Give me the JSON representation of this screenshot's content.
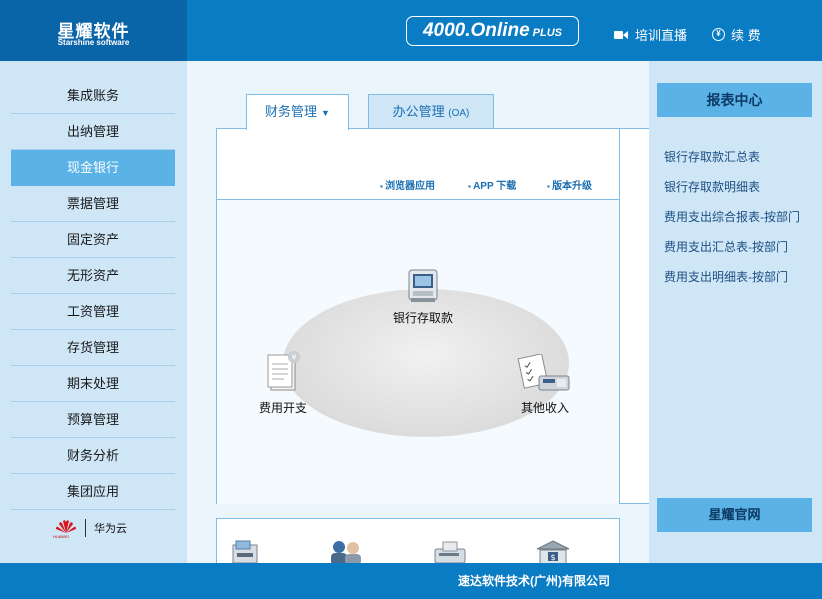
{
  "header": {
    "logo_title": "星耀软件",
    "logo_sub": "Starshine software",
    "product_name": "4000.Online",
    "product_plus": "PLUS",
    "live_label": "培训直播",
    "renew_label": "续 费"
  },
  "sidebar": {
    "items": [
      {
        "label": "集成账务"
      },
      {
        "label": "出纳管理"
      },
      {
        "label": "现金银行",
        "active": true
      },
      {
        "label": "票据管理"
      },
      {
        "label": "固定资产"
      },
      {
        "label": "无形资产"
      },
      {
        "label": "工资管理"
      },
      {
        "label": "存货管理"
      },
      {
        "label": "期末处理"
      },
      {
        "label": "预算管理"
      },
      {
        "label": "财务分析"
      },
      {
        "label": "集团应用"
      }
    ],
    "partner_brand": "HUAWEI",
    "partner_label": "华为云"
  },
  "tabs": {
    "finance": "财务管理",
    "office": "办公管理",
    "office_suffix": "(OA)"
  },
  "sublinks": {
    "browser": "浏览器应用",
    "app": "APP 下载",
    "upgrade": "版本升级"
  },
  "flow": {
    "bank": "银行存取款",
    "expense": "费用开支",
    "income": "其他收入"
  },
  "reports": {
    "title": "报表中心",
    "items": [
      "银行存取款汇总表",
      "银行存取款明细表",
      "费用支出综合报表-按部门",
      "费用支出汇总表-按部门",
      "费用支出明细表-按部门"
    ],
    "site_button": "星耀官网"
  },
  "footer": {
    "company": "速达软件技术(广州)有限公司"
  },
  "colors": {
    "header_blue": "#0a7cc4",
    "logo_blue": "#0a64a8",
    "sidebar_bg": "#cfe6f7",
    "active_blue": "#5ab2e7"
  }
}
